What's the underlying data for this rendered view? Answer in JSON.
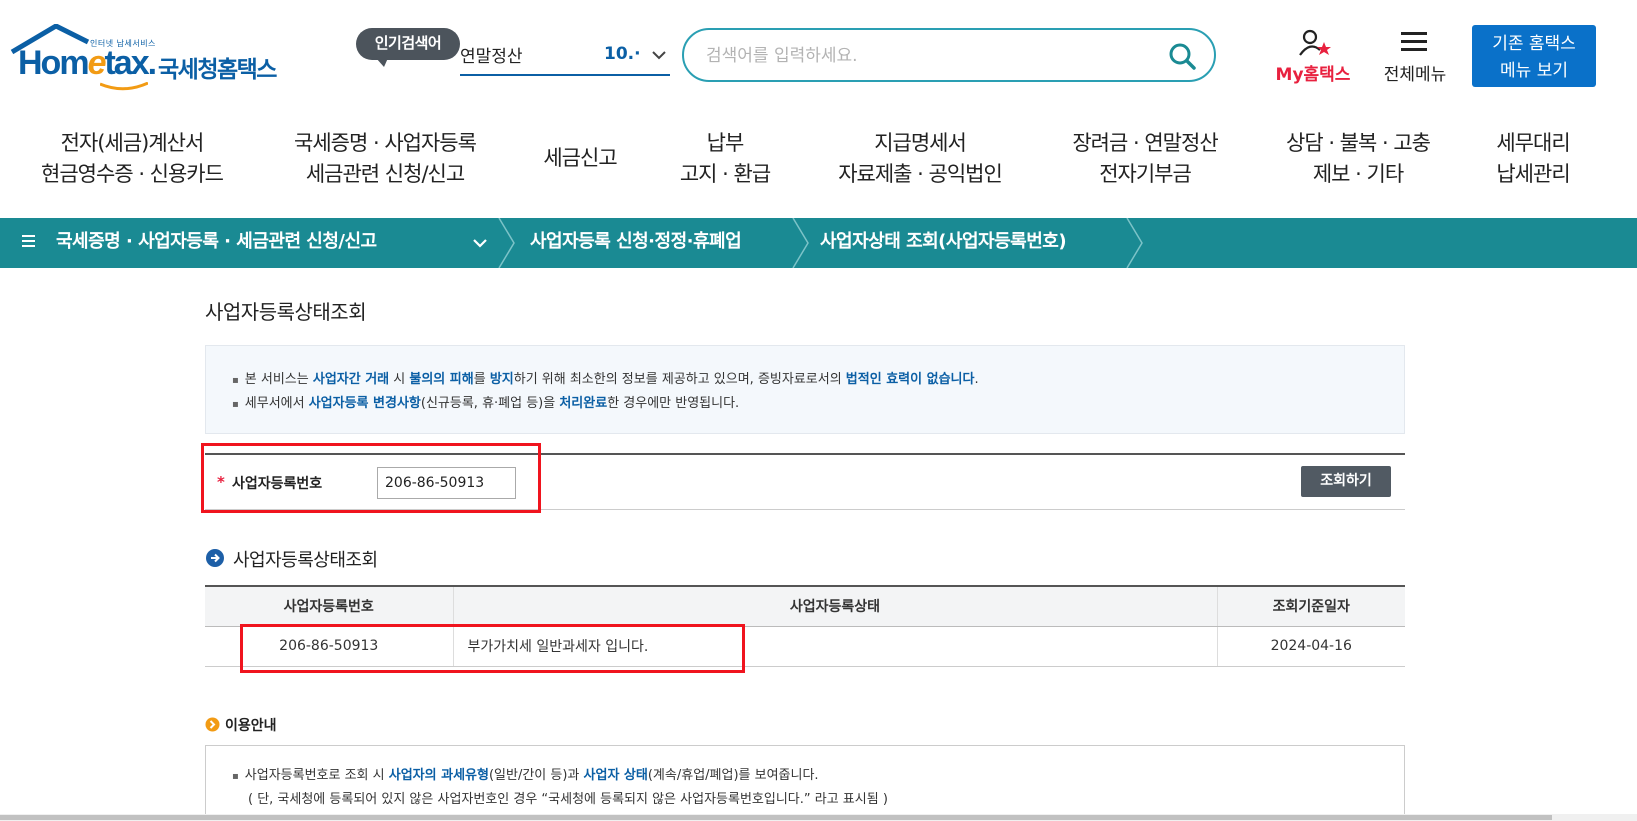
{
  "header": {
    "logo_tagline": "인터넷 납세서비스",
    "logo_word_a": "Hom",
    "logo_word_b": "e",
    "logo_word_c": "tax.",
    "logo_korean": "국세청홈택스",
    "popular_label": "인기검색어",
    "popular_term": "연말정산",
    "popular_rank": "10.·",
    "search_placeholder": "검색어를 입력하세요.",
    "my_hometax": "My홈택스",
    "all_menu": "전체메뉴",
    "old_menu_line1": "기존 홈택스",
    "old_menu_line2": "메뉴 보기"
  },
  "nav": [
    {
      "line1": "전자(세금)계산서",
      "line2": "현금영수증 · 신용카드"
    },
    {
      "line1": "국세증명 · 사업자등록",
      "line2": "세금관련 신청/신고"
    },
    {
      "line1": "세금신고",
      "line2": ""
    },
    {
      "line1": "납부",
      "line2": "고지 · 환급"
    },
    {
      "line1": "지급명세서",
      "line2": "자료제출 · 공익법인"
    },
    {
      "line1": "장려금 · 연말정산",
      "line2": "전자기부금"
    },
    {
      "line1": "상담 · 불복 · 고충",
      "line2": "제보 · 기타"
    },
    {
      "line1": "세무대리",
      "line2": "납세관리"
    }
  ],
  "breadcrumb": [
    "국세증명 · 사업자등록 · 세금관련 신청/신고",
    "사업자등록 신청·정정·휴폐업",
    "사업자상태 조회(사업자등록번호)"
  ],
  "page": {
    "title": "사업자등록상태조회",
    "notice": {
      "l1_a": "본 서비스는 ",
      "l1_b": "사업자간 거래",
      "l1_c": " 시 ",
      "l1_d": "불의의 피해",
      "l1_e": "를 ",
      "l1_f": "방지",
      "l1_g": "하기 위해 최소한의 정보를 제공하고 있으며, 증빙자료로서의 ",
      "l1_h": "법적인 효력이 없습니다",
      "l1_i": ".",
      "l2_a": "세무서에서 ",
      "l2_b": "사업자등록 변경사항",
      "l2_c": "(신규등록, 휴·폐업 등)을 ",
      "l2_d": "처리완료",
      "l2_e": "한 경우에만 반영됩니다."
    },
    "search": {
      "required_mark": "*",
      "label": "사업자등록번호",
      "value": "206-86-50913",
      "button": "조회하기"
    },
    "result": {
      "section_title": "사업자등록상태조회",
      "headers": [
        "사업자등록번호",
        "사업자등록상태",
        "조회기준일자"
      ],
      "rows": [
        {
          "bizno": "206-86-50913",
          "status": "부가가치세 일반과세자 입니다.",
          "date": "2024-04-16"
        }
      ]
    },
    "usage": {
      "title": "이용안내",
      "l1_a": "사업자등록번호로 조회 시 ",
      "l1_b": "사업자의 과세유형",
      "l1_c": "(일반/간이 등)과 ",
      "l1_d": "사업자 상태",
      "l1_e": "(계속/휴업/폐업)를 보여줍니다.",
      "l2": "( 단, 국세청에 등록되어 있지 않은 사업자번호인 경우 “국세청에 등록되지 않은 사업자등록번호입니다.” 라고 표시됨 )"
    }
  },
  "colors": {
    "brand_blue": "#0b5fa5",
    "teal_bar": "#1a8a93",
    "search_border": "#2a9fb3",
    "highlight_red": "#f0141e",
    "my_red": "#e8213f"
  }
}
